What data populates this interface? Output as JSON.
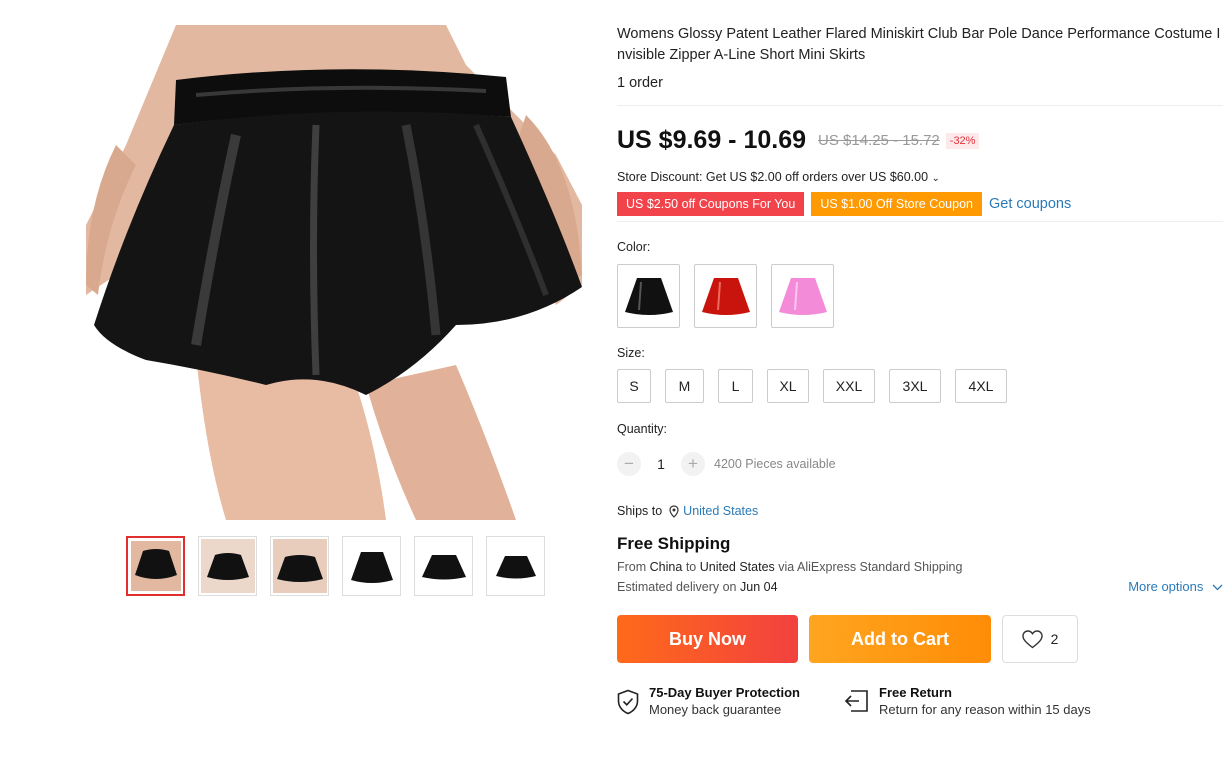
{
  "product": {
    "title": "Womens Glossy Patent Leather Flared Miniskirt Club Bar Pole Dance Performance Costume Invisible Zipper A-Line Short Mini Skirts",
    "orders": "1 order"
  },
  "price": {
    "current": "US $9.69 - 10.69",
    "original": "US $14.25 - 15.72",
    "discount": "-32%"
  },
  "store_discount": "Store Discount: Get US $2.00 off orders over US $60.00",
  "coupons": {
    "coupon1": "US $2.50 off Coupons For You",
    "coupon2": "US $1.00 Off Store Coupon",
    "get_label": "Get coupons"
  },
  "color": {
    "label": "Color:",
    "options": [
      {
        "name": "black",
        "color": "#111111"
      },
      {
        "name": "red",
        "color": "#c8140c"
      },
      {
        "name": "pink",
        "color": "#f38bd9"
      }
    ]
  },
  "size": {
    "label": "Size:",
    "options": [
      "S",
      "M",
      "L",
      "XL",
      "XXL",
      "3XL",
      "4XL"
    ]
  },
  "quantity": {
    "label": "Quantity:",
    "value": "1",
    "available": "4200 Pieces available"
  },
  "shipping": {
    "ships_to_label": "Ships to",
    "ships_to_country": "United States",
    "headline": "Free Shipping",
    "from_prefix": "From",
    "from_country": "China",
    "to_word": "to",
    "to_country": "United States",
    "via_text": "via AliExpress Standard Shipping",
    "est_prefix": "Estimated delivery on",
    "est_date": "Jun 04",
    "more_options": "More options"
  },
  "actions": {
    "buy_now": "Buy Now",
    "add_to_cart": "Add to Cart",
    "wishlist_count": "2"
  },
  "guarantees": {
    "protection_title": "75-Day Buyer Protection",
    "protection_sub": "Money back guarantee",
    "return_title": "Free Return",
    "return_sub": "Return for any reason within 15 days"
  },
  "gallery": {
    "thumbnails": [
      "thumb-1",
      "thumb-2",
      "thumb-3",
      "thumb-4",
      "thumb-5",
      "thumb-6"
    ]
  },
  "colors": {
    "accent_red": "#f2424a",
    "accent_orange": "#ff9a02",
    "link_blue": "#2a7ab8"
  }
}
